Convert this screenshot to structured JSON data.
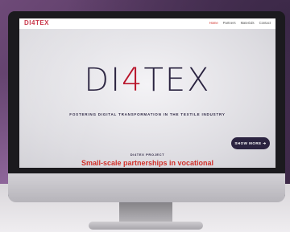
{
  "site": {
    "logo": "DI4TEX",
    "nav": [
      "Home",
      "Partners",
      "Materials",
      "Contact"
    ],
    "hero_logo": {
      "part1": "DI",
      "part2": "4",
      "part3": "TEX"
    },
    "tagline": "FOSTERING DIGITAL TRANSFORMATION IN THE TEXTILE INDUSTRY",
    "button": "SHOW MORE ➔",
    "project_label": "DI4TEX PROJECT",
    "partner_heading": "Small-scale partnerships in vocational"
  }
}
